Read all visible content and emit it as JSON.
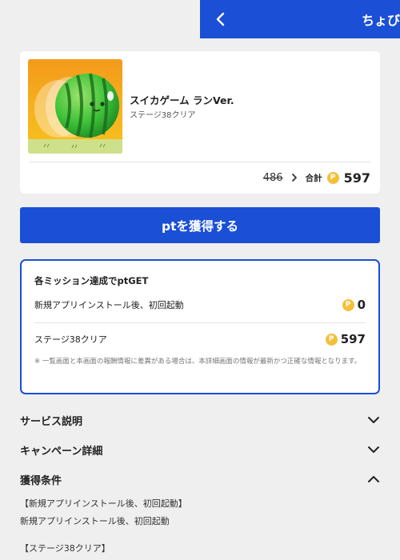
{
  "header": {
    "title": "ちょびリッチ",
    "back_icon": "chevron-left-icon",
    "bg_color": "#1a4fd6"
  },
  "offer": {
    "app_name": "スイカゲーム ランVer.",
    "condition": "ステージ38クリア",
    "old_points": "486",
    "total_label": "合計",
    "coin_symbol": "P",
    "total_points": "597"
  },
  "cta": {
    "label": "ptを獲得する"
  },
  "missions": {
    "heading": "各ミッション達成でptGET",
    "items": [
      {
        "label": "新規アプリインストール後、初回起動",
        "points": "0"
      },
      {
        "label": "ステージ38クリア",
        "points": "597"
      }
    ],
    "notice": "※ 一覧画面と本画面の報酬情報に差異がある場合は、本詳細画面の情報が最新かつ正確な情報となります。"
  },
  "sections": {
    "service": "サービス説明",
    "campaign": "キャンペーン詳細",
    "conditions": "獲得条件"
  },
  "conditions": {
    "item1_title": "【新規アプリインストール後、初回起動】",
    "item1_body": "新規アプリインストール後、初回起動",
    "item2_title": "【ステージ38クリア】"
  },
  "colors": {
    "accent": "#1a4fd6",
    "coin": "#f3c03a",
    "background": "#efefef"
  }
}
